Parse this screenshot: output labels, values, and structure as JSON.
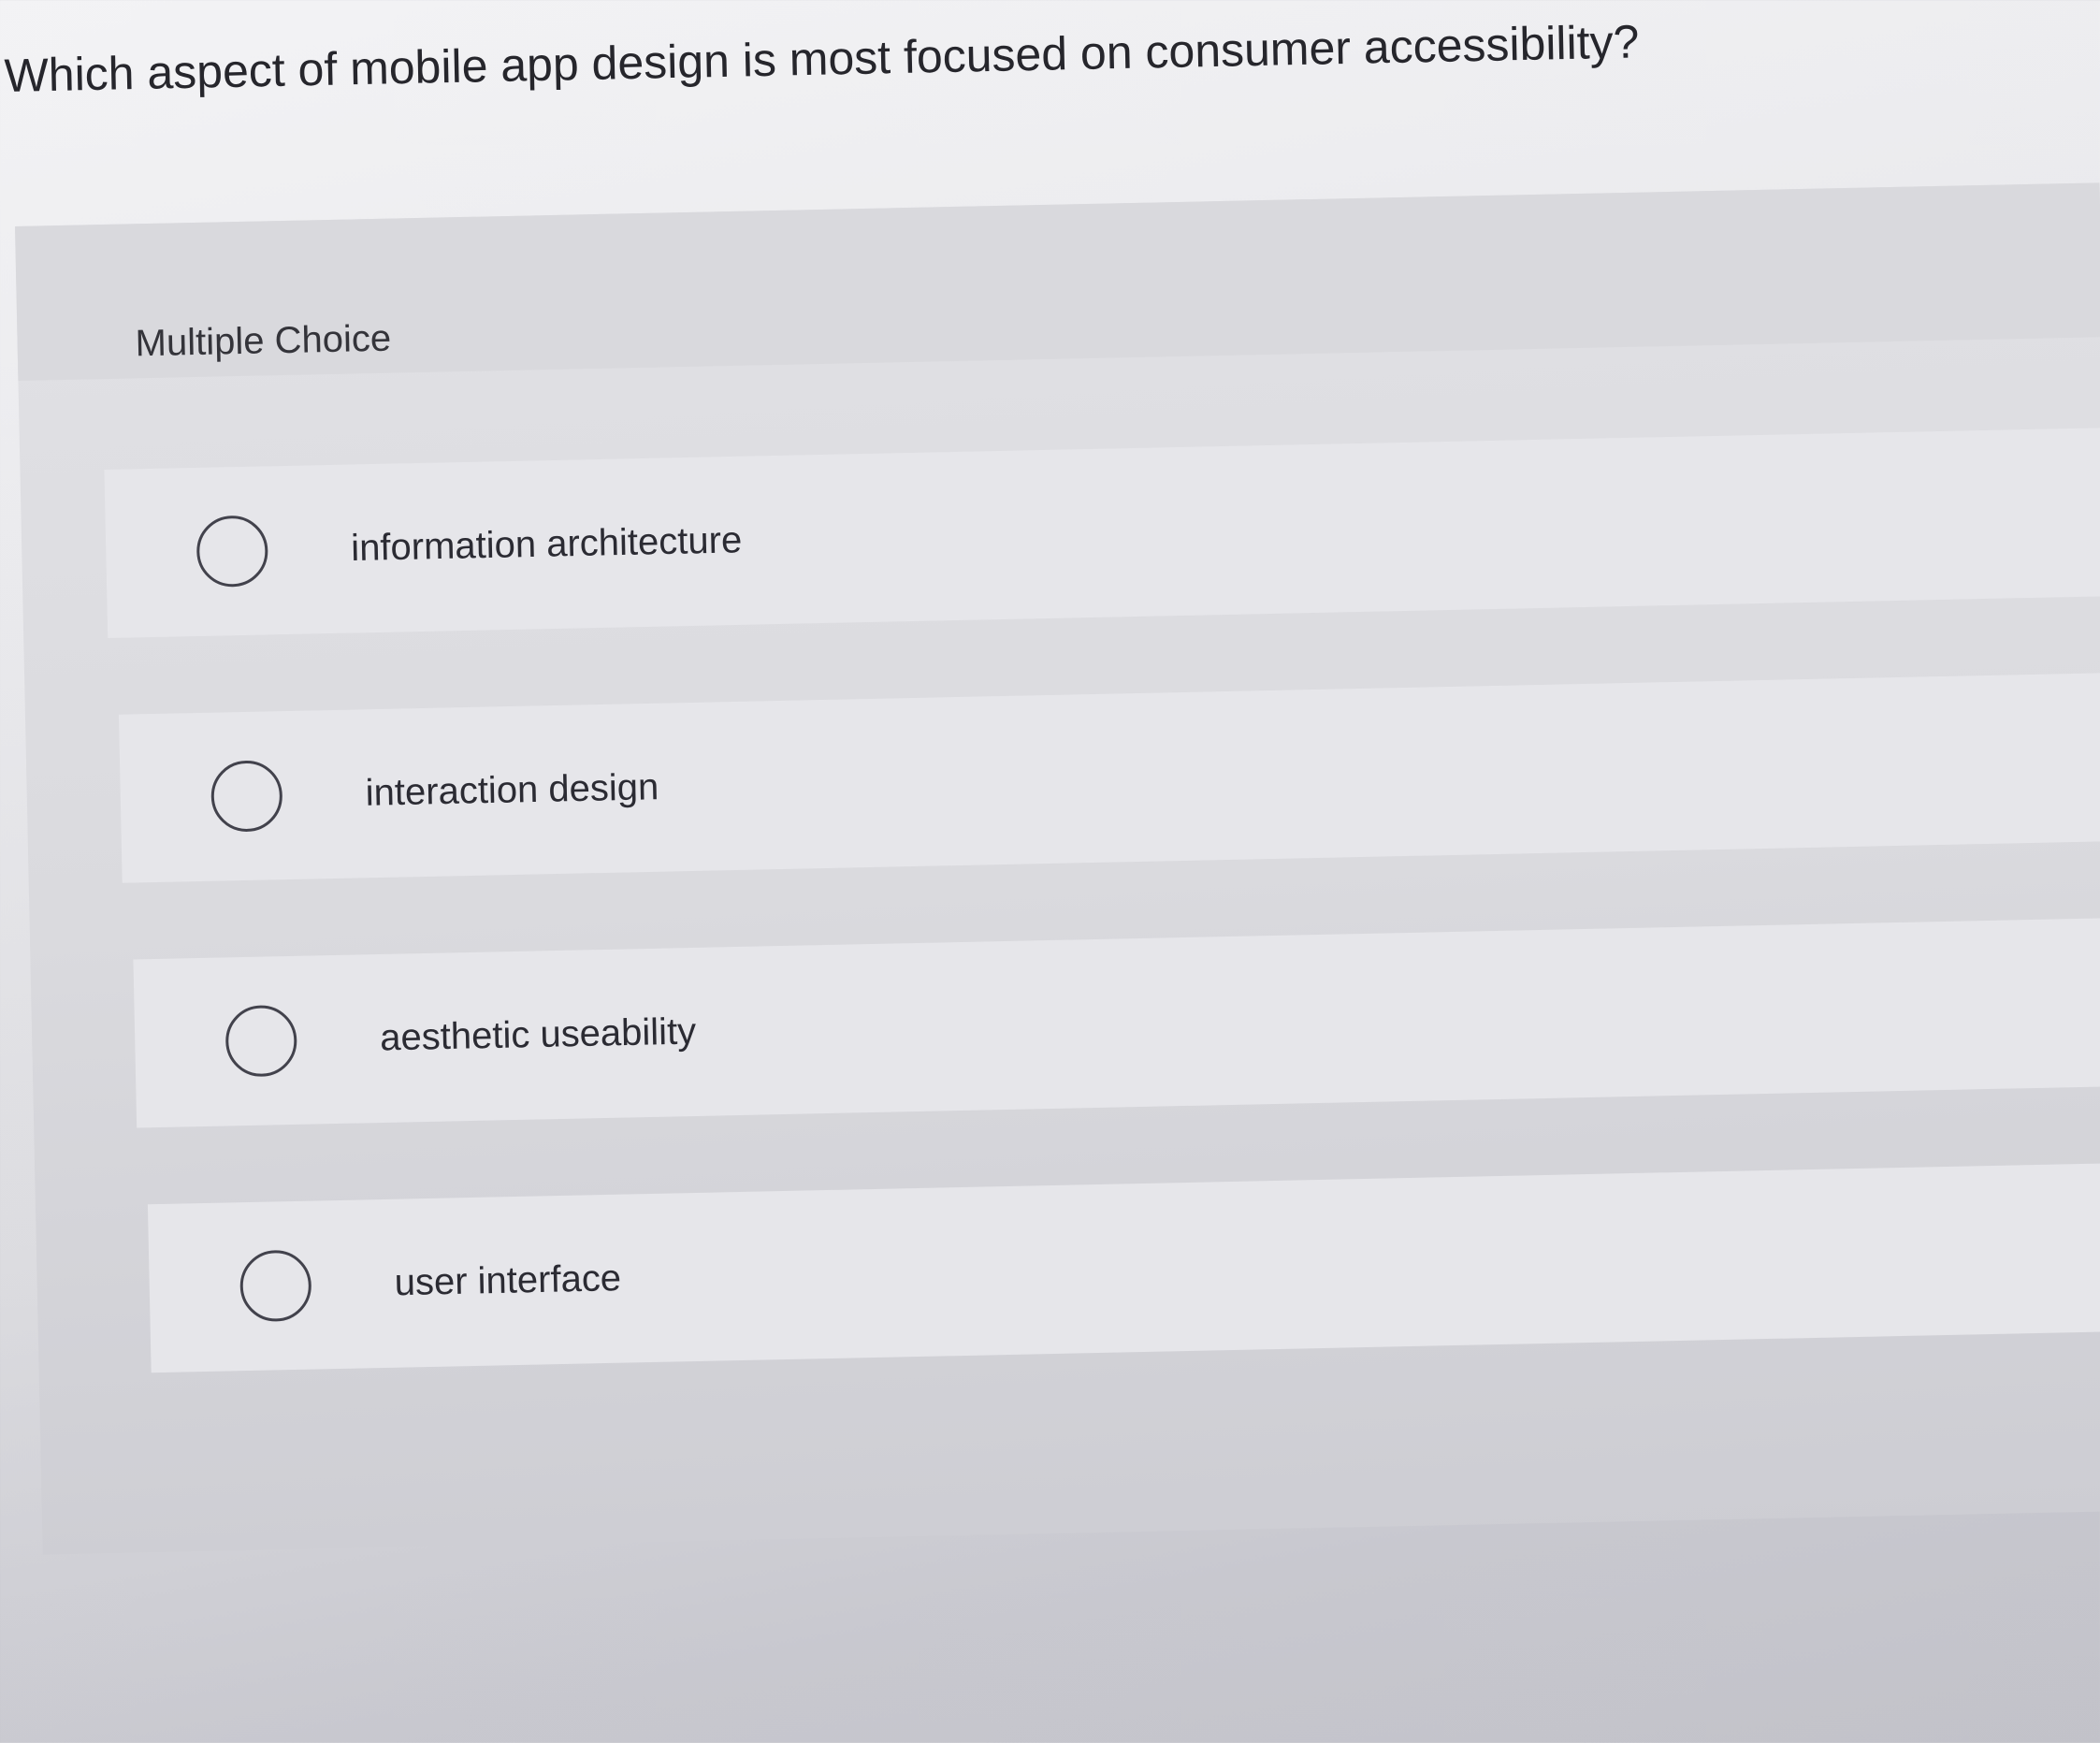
{
  "question": "Which aspect of mobile app design is most focused on consumer accessibility?",
  "question_type": "Multiple Choice",
  "options": [
    {
      "label": "information architecture",
      "selected": false
    },
    {
      "label": "interaction design",
      "selected": false
    },
    {
      "label": "aesthetic useability",
      "selected": false
    },
    {
      "label": "user interface",
      "selected": false
    }
  ]
}
